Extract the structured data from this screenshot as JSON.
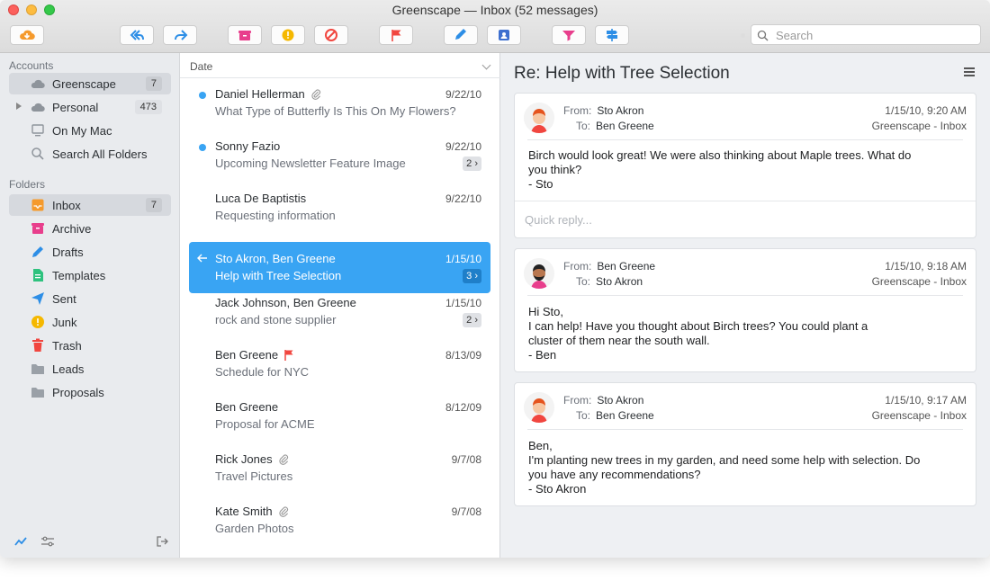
{
  "window": {
    "title": "Greenscape — Inbox (52 messages)"
  },
  "search": {
    "placeholder": "Search"
  },
  "sidebar": {
    "accounts_header": "Accounts",
    "accounts": [
      {
        "label": "Greenscape",
        "count": "7"
      },
      {
        "label": "Personal",
        "count": "473"
      },
      {
        "label": "On My Mac",
        "count": ""
      },
      {
        "label": "Search All Folders",
        "count": ""
      }
    ],
    "folders_header": "Folders",
    "folders": [
      {
        "label": "Inbox",
        "count": "7"
      },
      {
        "label": "Archive"
      },
      {
        "label": "Drafts"
      },
      {
        "label": "Templates"
      },
      {
        "label": "Sent"
      },
      {
        "label": "Junk"
      },
      {
        "label": "Trash"
      },
      {
        "label": "Leads"
      },
      {
        "label": "Proposals"
      }
    ]
  },
  "list": {
    "sort_label": "Date",
    "messages": [
      {
        "from": "Daniel Hellerman",
        "subject": "What Type of Butterfly Is This On My Flowers?",
        "date": "9/22/10",
        "thread": ""
      },
      {
        "from": "Sonny Fazio",
        "subject": "Upcoming Newsletter Feature Image",
        "date": "9/22/10",
        "thread": "2"
      },
      {
        "from": "Luca De Baptistis",
        "subject": "Requesting information",
        "date": "9/22/10",
        "thread": ""
      },
      {
        "from": "Sto Akron, Ben Greene",
        "subject": "Help with Tree Selection",
        "date": "1/15/10",
        "thread": "3"
      },
      {
        "from": "Jack Johnson, Ben Greene",
        "subject": "rock and stone supplier",
        "date": "1/15/10",
        "thread": "2"
      },
      {
        "from": "Ben Greene",
        "subject": "Schedule for NYC",
        "date": "8/13/09",
        "thread": ""
      },
      {
        "from": "Ben Greene",
        "subject": "Proposal for ACME",
        "date": "8/12/09",
        "thread": ""
      },
      {
        "from": "Rick Jones",
        "subject": "Travel Pictures",
        "date": "9/7/08",
        "thread": ""
      },
      {
        "from": "Kate Smith",
        "subject": "Garden Photos",
        "date": "9/7/08",
        "thread": ""
      }
    ]
  },
  "reader": {
    "title": "Re: Help with Tree Selection",
    "from_label": "From:",
    "to_label": "To:",
    "quick_reply": "Quick reply...",
    "messages": [
      {
        "from": "Sto Akron",
        "to": "Ben Greene",
        "date": "1/15/10, 9:20 AM",
        "account": "Greenscape - Inbox",
        "body": "Birch would look great!  We were also thinking about Maple trees.  What do\nyou think?\n- Sto"
      },
      {
        "from": "Ben Greene",
        "to": "Sto Akron",
        "date": "1/15/10, 9:18 AM",
        "account": "Greenscape - Inbox",
        "body": "Hi Sto,\nI can help!  Have you thought about Birch trees?  You could plant a\ncluster of them near the south wall.\n- Ben"
      },
      {
        "from": "Sto Akron",
        "to": "Ben Greene",
        "date": "1/15/10, 9:17 AM",
        "account": "Greenscape - Inbox",
        "body": "Ben,\nI'm planting new trees in my garden, and need some help with selection.  Do\nyou have any recommendations?\n- Sto Akron"
      }
    ]
  },
  "colors": {
    "accent": "#39a4f3",
    "flag": "#f1463f"
  }
}
